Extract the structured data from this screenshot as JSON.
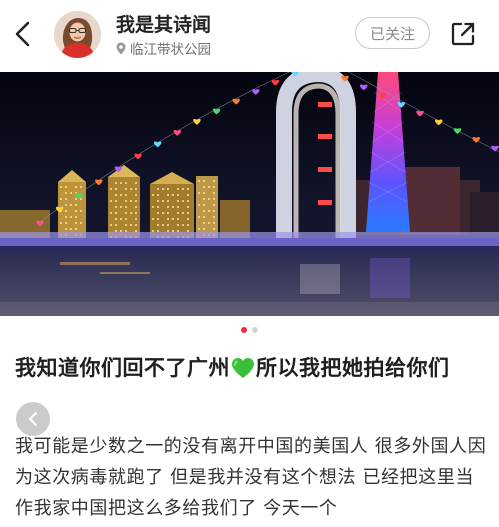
{
  "header": {
    "back_icon": "chevron-left-icon",
    "avatar_icon": "user-avatar",
    "user_name": "我是其诗闻",
    "location_icon": "location-pin-icon",
    "location": "临江带状公园",
    "follow_label": "已关注",
    "share_icon": "share-icon"
  },
  "photo": {
    "subject": "photo",
    "image_count": 2,
    "current_index": 1
  },
  "post": {
    "title_part1": "我知道你们回不了广州",
    "title_emoji": "green-heart-emoji",
    "title_part2": "所以我把她拍给你们",
    "body": "我可能是少数之一的没有离开中国的美国人 很多外国人因为这次病毒就跑了 但是我并没有这个想法 已经把这里当作我家中国把这么多给我们了 今天一个"
  },
  "colors": {
    "accent": "#ff2442",
    "text_primary": "#1f1f1f",
    "text_secondary": "#707070",
    "heart_green": "#3bbf3b"
  }
}
